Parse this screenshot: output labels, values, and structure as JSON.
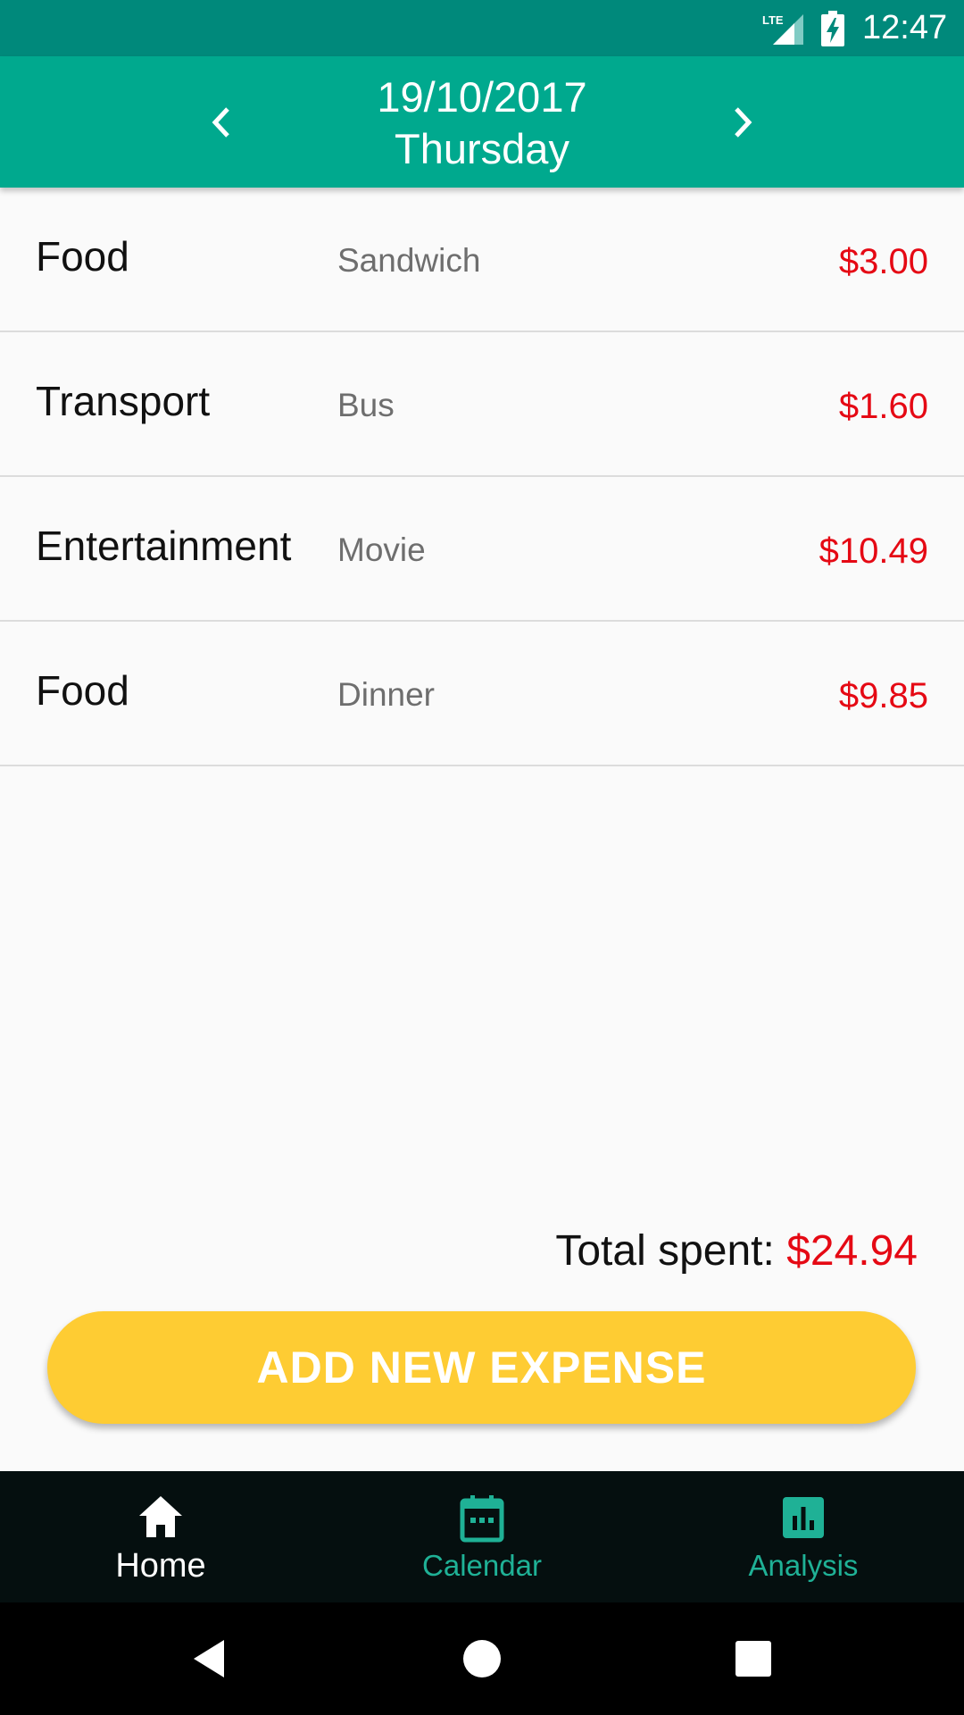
{
  "status_bar": {
    "network_label": "LTE",
    "time": "12:47",
    "icons": [
      "lte-signal-icon",
      "battery-charging-icon"
    ]
  },
  "header": {
    "date": "19/10/2017",
    "weekday": "Thursday",
    "prev_icon": "chevron-left-icon",
    "next_icon": "chevron-right-icon",
    "background_color": "#00a98e"
  },
  "expenses": [
    {
      "category": "Food",
      "note": "Sandwich",
      "amount": "$3.00"
    },
    {
      "category": "Transport",
      "note": "Bus",
      "amount": "$1.60"
    },
    {
      "category": "Entertainment",
      "note": "Movie",
      "amount": "$10.49"
    },
    {
      "category": "Food",
      "note": "Dinner",
      "amount": "$9.85"
    }
  ],
  "summary": {
    "total_label": "Total spent:",
    "total_value": "$24.94"
  },
  "actions": {
    "add_expense_label": "ADD NEW EXPENSE",
    "button_color": "#fecc33"
  },
  "bottom_nav": {
    "items": [
      {
        "label": "Home",
        "icon": "home-icon",
        "active": true
      },
      {
        "label": "Calendar",
        "icon": "calendar-icon",
        "active": false
      },
      {
        "label": "Analysis",
        "icon": "bar-chart-icon",
        "active": false
      }
    ],
    "active_color": "#ffffff",
    "inactive_color": "#1fb196"
  },
  "colors": {
    "status_bar": "#00897b",
    "amount": "#e50914",
    "nav_background": "#050f0f"
  }
}
